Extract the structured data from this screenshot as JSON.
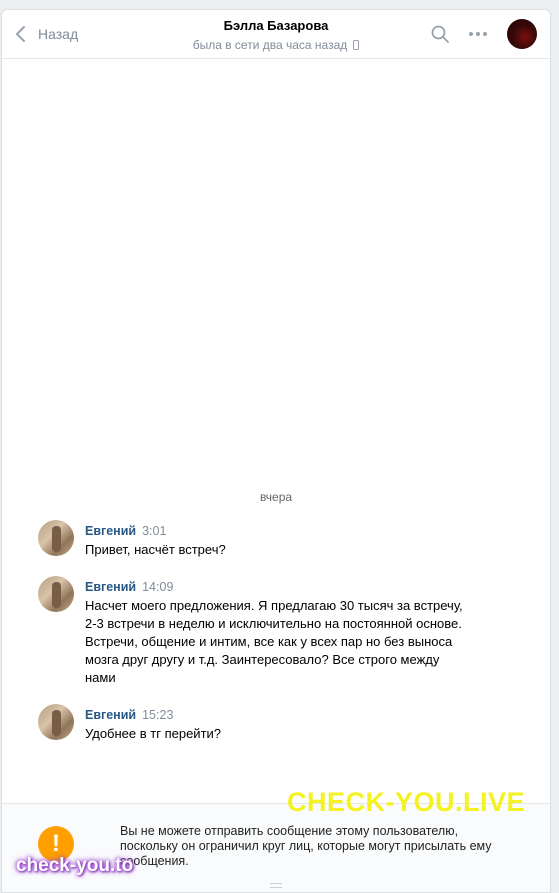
{
  "header": {
    "back_label": "Назад",
    "peer_name": "Бэлла Базарова",
    "peer_status": "была в сети два часа назад"
  },
  "day_separator": "вчера",
  "messages": [
    {
      "author": "Евгений",
      "time": "3:01",
      "text": "Привет, насчёт встреч?"
    },
    {
      "author": "Евгений",
      "time": "14:09",
      "text": "Насчет моего предложения. Я предлагаю 30 тысяч за встречу,\n2-3 встречи в неделю и исключительно на постоянной основе.\nВстречи, общение и интим, все как у всех пар но без выноса\nмозга друг другу и т.д. Заинтересовало? Все строго между\nнами"
    },
    {
      "author": "Евгений",
      "time": "15:23",
      "text": "Удобнее в тг перейти?"
    }
  ],
  "footer": {
    "warning_text": "Вы не можете отправить сообщение этому пользователю, поскольку он ограничил круг лиц, которые могут присылать ему сообщения.",
    "warning_icon": "exclamation-icon",
    "warning_color": "#ffa000"
  },
  "watermarks": {
    "primary": "CHECK-YOU.LIVE",
    "secondary": "check-you.to"
  },
  "icons": {
    "back": "chevron-left-icon",
    "search": "search-icon",
    "more": "more-dots-icon",
    "status": "mobile-phone-icon"
  },
  "colors": {
    "accent_link": "#2a5885",
    "secondary_text": "#818c99",
    "watermark_yellow": "#f5f224"
  }
}
